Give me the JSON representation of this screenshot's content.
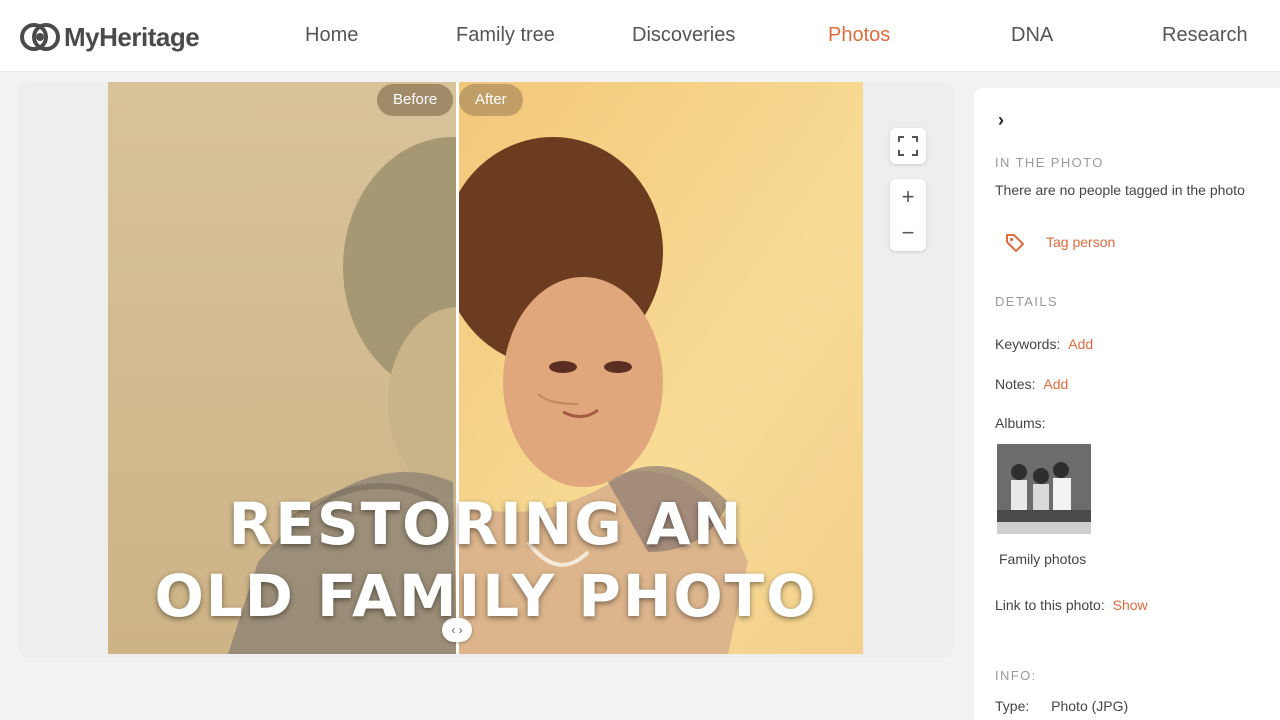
{
  "header": {
    "logo_text": "MyHeritage",
    "nav": [
      {
        "label": "Home",
        "active": false
      },
      {
        "label": "Family tree",
        "active": false
      },
      {
        "label": "Discoveries",
        "active": false
      },
      {
        "label": "Photos",
        "active": true
      },
      {
        "label": "DNA",
        "active": false
      },
      {
        "label": "Research",
        "active": false
      }
    ]
  },
  "viewer": {
    "before_label": "Before",
    "after_label": "After",
    "split_handle_icon": "left-right-arrows-icon",
    "split_handle_glyph": "‹ ›",
    "overlay_line1": "RESTORING AN",
    "overlay_line2": "OLD FAMILY PHOTO",
    "zoom_in": "+",
    "zoom_out": "−",
    "fullscreen_icon": "fullscreen-icon"
  },
  "sidebar": {
    "collapse_glyph": "›",
    "in_photo_title": "IN THE PHOTO",
    "no_people_text": "There are no people tagged in the photo",
    "tag_person_label": "Tag person",
    "details_title": "DETAILS",
    "keywords_label": "Keywords:",
    "keywords_action": "Add",
    "notes_label": "Notes:",
    "notes_action": "Add",
    "albums_label": "Albums:",
    "album_name": "Family photos",
    "link_label": "Link to this photo:",
    "link_action": "Show",
    "info_title": "INFO:",
    "type_label": "Type:",
    "type_value": "Photo (JPG)"
  },
  "colors": {
    "accent": "#e06b3d",
    "nav_text": "#555555",
    "section_title": "#999999"
  }
}
